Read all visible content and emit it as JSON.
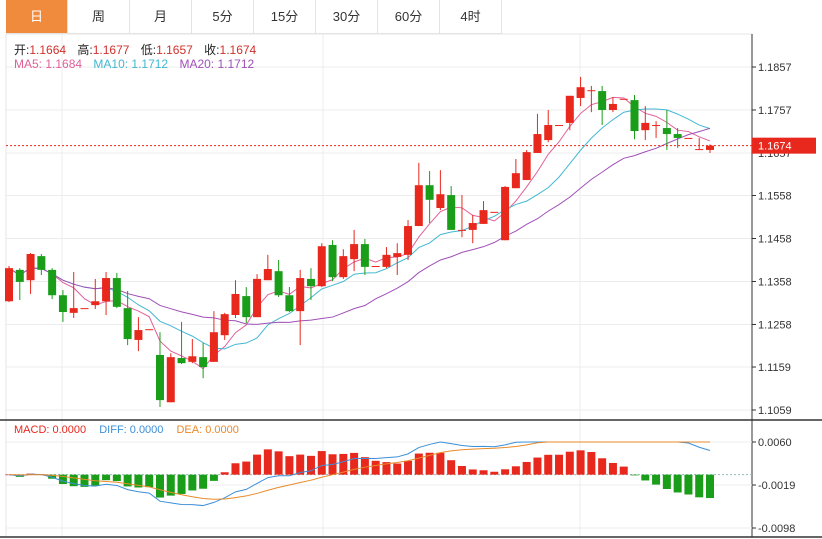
{
  "tabs": [
    {
      "label": "日",
      "active": true
    },
    {
      "label": "周"
    },
    {
      "label": "月"
    },
    {
      "label": "5分"
    },
    {
      "label": "15分"
    },
    {
      "label": "30分"
    },
    {
      "label": "60分"
    },
    {
      "label": "4时"
    }
  ],
  "ohlc_info": {
    "open_label": "开:",
    "open": "1.1664",
    "high_label": "高:",
    "high": "1.1677",
    "low_label": "低:",
    "low": "1.1657",
    "close_label": "收:",
    "close": "1.1674"
  },
  "ma_info": {
    "ma5": "MA5: 1.1684",
    "ma10": "MA10: 1.1712",
    "ma20": "MA20: 1.1712"
  },
  "macd_info": {
    "macd": "MACD: 0.0000",
    "diff": "DIFF: 0.0000",
    "dea": "DEA: 0.0000"
  },
  "colors": {
    "up": "#e8281d",
    "down": "#1a9e1a",
    "ma5": "#e0609a",
    "ma10": "#44b8d2",
    "ma20": "#a050b8",
    "diff": "#3c8fd8",
    "dea": "#e88a2a",
    "active_tab": "#f08a3c"
  },
  "chart_data": [
    {
      "type": "candlestick",
      "ylim": [
        1.1059,
        1.1857
      ],
      "y_ticks": [
        "1.1857",
        "1.1757",
        "1.1657",
        "1.1558",
        "1.1458",
        "1.1358",
        "1.1258",
        "1.1159",
        "1.1059"
      ],
      "last_price": "1.1674",
      "moving_averages": [
        "MA5",
        "MA10",
        "MA20"
      ],
      "ohlc": [
        [
          1.1312,
          1.1394,
          1.131,
          1.1389
        ],
        [
          1.1385,
          1.1389,
          1.1315,
          1.1357
        ],
        [
          1.1361,
          1.1424,
          1.1329,
          1.1422
        ],
        [
          1.1417,
          1.1422,
          1.1373,
          1.1385
        ],
        [
          1.1385,
          1.1389,
          1.1317,
          1.1326
        ],
        [
          1.1326,
          1.1338,
          1.1264,
          1.1287
        ],
        [
          1.1285,
          1.138,
          1.1273,
          1.1296
        ],
        [
          1.1296,
          1.1296,
          1.1296,
          1.1296
        ],
        [
          1.1303,
          1.1364,
          1.1294,
          1.1312
        ],
        [
          1.1312,
          1.138,
          1.128,
          1.1366
        ],
        [
          1.1366,
          1.1378,
          1.1296,
          1.1299
        ],
        [
          1.1296,
          1.1336,
          1.121,
          1.1224
        ],
        [
          1.1222,
          1.1275,
          1.1196,
          1.1245
        ],
        [
          1.1247,
          1.1247,
          1.1247,
          1.1247
        ],
        [
          1.1187,
          1.124,
          1.1066,
          1.1082
        ],
        [
          1.1077,
          1.1191,
          1.1077,
          1.1182
        ],
        [
          1.118,
          1.1264,
          1.1166,
          1.1168
        ],
        [
          1.1171,
          1.1224,
          1.1168,
          1.1184
        ],
        [
          1.1182,
          1.1215,
          1.1133,
          1.1159
        ],
        [
          1.1171,
          1.1289,
          1.1171,
          1.124
        ],
        [
          1.1233,
          1.1285,
          1.1222,
          1.1282
        ],
        [
          1.128,
          1.1361,
          1.1273,
          1.1329
        ],
        [
          1.1324,
          1.1345,
          1.1261,
          1.1275
        ],
        [
          1.1275,
          1.1375,
          1.1275,
          1.1364
        ],
        [
          1.1361,
          1.142,
          1.1361,
          1.1387
        ],
        [
          1.1382,
          1.1408,
          1.1322,
          1.1326
        ],
        [
          1.1326,
          1.1345,
          1.1287,
          1.1289
        ],
        [
          1.1289,
          1.1385,
          1.121,
          1.1366
        ],
        [
          1.1364,
          1.1389,
          1.1315,
          1.1347
        ],
        [
          1.1347,
          1.1447,
          1.1345,
          1.144
        ],
        [
          1.1443,
          1.1454,
          1.1359,
          1.1368
        ],
        [
          1.1368,
          1.1433,
          1.1364,
          1.1417
        ],
        [
          1.141,
          1.1478,
          1.1382,
          1.1445
        ],
        [
          1.1445,
          1.1457,
          1.1373,
          1.1392
        ],
        [
          1.1394,
          1.1394,
          1.1394,
          1.1394
        ],
        [
          1.1392,
          1.1438,
          1.1389,
          1.142
        ],
        [
          1.1415,
          1.1447,
          1.1373,
          1.1424
        ],
        [
          1.142,
          1.1501,
          1.1408,
          1.1487
        ],
        [
          1.1487,
          1.1634,
          1.1487,
          1.1582
        ],
        [
          1.1582,
          1.1615,
          1.1494,
          1.1548
        ],
        [
          1.1529,
          1.1617,
          1.1524,
          1.1561
        ],
        [
          1.1559,
          1.158,
          1.1478,
          1.1478
        ],
        [
          1.1478,
          1.1559,
          1.1461,
          1.1478
        ],
        [
          1.1478,
          1.1513,
          1.1447,
          1.1494
        ],
        [
          1.1492,
          1.1545,
          1.1492,
          1.1524
        ],
        [
          1.152,
          1.152,
          1.152,
          1.152
        ],
        [
          1.1454,
          1.158,
          1.1454,
          1.1578
        ],
        [
          1.1575,
          1.1643,
          1.1575,
          1.161
        ],
        [
          1.1594,
          1.1664,
          1.1594,
          1.1659
        ],
        [
          1.1657,
          1.1748,
          1.1657,
          1.1701
        ],
        [
          1.1687,
          1.1757,
          1.1682,
          1.1722
        ],
        [
          1.1722,
          1.1722,
          1.1722,
          1.1722
        ],
        [
          1.1727,
          1.179,
          1.171,
          1.179
        ],
        [
          1.1785,
          1.1834,
          1.1766,
          1.181
        ],
        [
          1.1803,
          1.1813,
          1.1752,
          1.1803
        ],
        [
          1.1801,
          1.1813,
          1.1722,
          1.1757
        ],
        [
          1.1757,
          1.1787,
          1.1752,
          1.1771
        ],
        [
          1.1783,
          1.1783,
          1.1783,
          1.1783
        ],
        [
          1.178,
          1.1792,
          1.1689,
          1.1708
        ],
        [
          1.171,
          1.1766,
          1.1687,
          1.1727
        ],
        [
          1.1722,
          1.1731,
          1.1692,
          1.1722
        ],
        [
          1.1715,
          1.1757,
          1.1664,
          1.1701
        ],
        [
          1.1701,
          1.1715,
          1.1669,
          1.1692
        ],
        [
          1.1692,
          1.1692,
          1.1692,
          1.1692
        ],
        [
          1.1666,
          1.1692,
          1.1664,
          1.1666
        ],
        [
          1.1664,
          1.1677,
          1.1657,
          1.1674
        ]
      ]
    },
    {
      "type": "bar",
      "indicator": "MACD",
      "ylim": [
        -0.0098,
        0.006
      ],
      "y_ticks": [
        "0.0060",
        "-0.0019",
        "-0.0098"
      ]
    }
  ]
}
